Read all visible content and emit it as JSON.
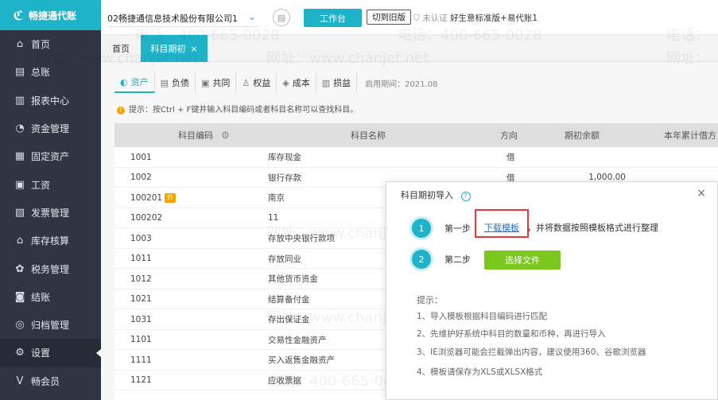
{
  "brand": {
    "logo_text": "畅捷通代账"
  },
  "sidebar": {
    "items": [
      {
        "label": "首页",
        "icon": "home-icon",
        "glyph": "⌂"
      },
      {
        "label": "总账",
        "icon": "ledger-icon",
        "glyph": "▤"
      },
      {
        "label": "报表中心",
        "icon": "chart-icon",
        "glyph": "▥"
      },
      {
        "label": "资金管理",
        "icon": "money-bag-icon",
        "glyph": "◔"
      },
      {
        "label": "固定资产",
        "icon": "building-icon",
        "glyph": "▦"
      },
      {
        "label": "工资",
        "icon": "salary-icon",
        "glyph": "▣"
      },
      {
        "label": "发票管理",
        "icon": "invoice-icon",
        "glyph": "▧"
      },
      {
        "label": "库存核算",
        "icon": "warehouse-icon",
        "glyph": "⌂"
      },
      {
        "label": "税务管理",
        "icon": "tax-icon",
        "glyph": "✿"
      },
      {
        "label": "结账",
        "icon": "checkout-icon",
        "glyph": "◙"
      },
      {
        "label": "归档管理",
        "icon": "archive-icon",
        "glyph": "◎"
      },
      {
        "label": "设置",
        "icon": "gear-icon",
        "glyph": "⚙"
      },
      {
        "label": "畅会员",
        "icon": "vip-icon",
        "glyph": "V"
      }
    ],
    "active_index": 11
  },
  "header": {
    "company": "02畅捷通信息技术股份有限公司1",
    "work_button": "工作台",
    "old_version_button": "切到旧版",
    "auth_status": "未认证",
    "product": "好生意标准版+易代账1"
  },
  "tabs": {
    "home": "首页",
    "active": "科目期初",
    "close": "×"
  },
  "subtabs": {
    "items": [
      {
        "label": "资产",
        "glyph": "◐"
      },
      {
        "label": "负债",
        "glyph": "▤"
      },
      {
        "label": "共同",
        "glyph": "▣"
      },
      {
        "label": "权益",
        "glyph": "♙"
      },
      {
        "label": "成本",
        "glyph": "◈"
      },
      {
        "label": "损益",
        "glyph": "▥"
      }
    ],
    "enable_date": "启用期间：2021.08"
  },
  "hint": {
    "text": "提示：按Ctrl + F键并输入科目编码或者科目名称可以查找科目。"
  },
  "table": {
    "columns": {
      "code": "科目编码",
      "name": "科目名称",
      "direction": "方向",
      "opening": "期初余额",
      "ytd_debit": "本年累计借方"
    },
    "rows": [
      {
        "code": "1001",
        "name": "库存现金",
        "direction": "借",
        "opening": "",
        "badge": ""
      },
      {
        "code": "1002",
        "name": "银行存款",
        "direction": "借",
        "opening": "1,000.00",
        "badge": ""
      },
      {
        "code": "100201",
        "name": "南京",
        "direction": "",
        "opening": "",
        "badge": "外"
      },
      {
        "code": "100202",
        "name": "11",
        "direction": "",
        "opening": "",
        "badge": ""
      },
      {
        "code": "1003",
        "name": "存放中央银行款项",
        "direction": "",
        "opening": "",
        "badge": ""
      },
      {
        "code": "1011",
        "name": "存放同业",
        "direction": "",
        "opening": "",
        "badge": ""
      },
      {
        "code": "1012",
        "name": "其他货币资金",
        "direction": "",
        "opening": "",
        "badge": ""
      },
      {
        "code": "1021",
        "name": "结算备付金",
        "direction": "",
        "opening": "",
        "badge": ""
      },
      {
        "code": "1031",
        "name": "存出保证金",
        "direction": "",
        "opening": "",
        "badge": ""
      },
      {
        "code": "1101",
        "name": "交易性金融资产",
        "direction": "",
        "opening": "",
        "badge": ""
      },
      {
        "code": "1111",
        "name": "买入返售金融资产",
        "direction": "",
        "opening": "",
        "badge": ""
      },
      {
        "code": "1121",
        "name": "应收票据",
        "direction": "",
        "opening": "",
        "badge": ""
      }
    ]
  },
  "modal": {
    "title": "科目期初导入",
    "help": "?",
    "close": "×",
    "step1_num": "1",
    "step1_label": "第一步",
    "download_link": "下载模板",
    "step1_rest": "，并将数据按照模板格式进行整理",
    "step2_num": "2",
    "step2_label": "第二步",
    "choose_file": "选择文件",
    "tips_title": "提示：",
    "tips": [
      "1、导入模板根据科目编码进行匹配",
      "2、先维护好系统中科目的数量和币种，再进行导入",
      "3、IE浏览器可能会拦截弹出内容，建议使用360、谷歌浏览器",
      "4、模板请保存为XLS或XLSX格式"
    ]
  },
  "colors": {
    "accent": "#1fb3c9",
    "sidebar_bg": "#2f3541",
    "green_button": "#7cc71d",
    "highlight_red": "#e53935"
  },
  "watermark": {
    "phone": "电话：400-665-0028",
    "site": "网址：www.chanjet.net",
    "phone_short": "电话：",
    "site_short": "网址："
  }
}
